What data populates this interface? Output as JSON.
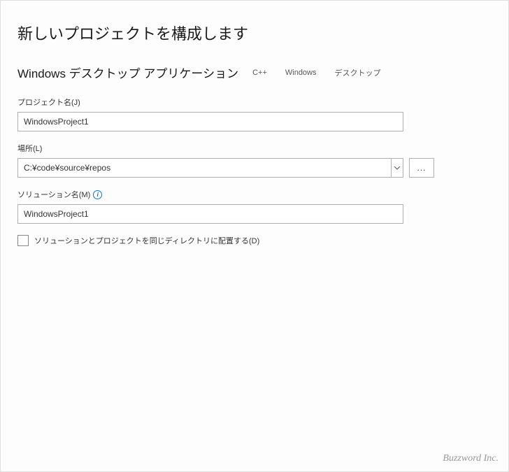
{
  "title": "新しいプロジェクトを構成します",
  "template": {
    "name": "Windows デスクトップ アプリケーション",
    "tags": [
      "C++",
      "Windows",
      "デスクトップ"
    ]
  },
  "fields": {
    "projectName": {
      "label": "プロジェクト名(J)",
      "value": "WindowsProject1"
    },
    "location": {
      "label": "場所(L)",
      "value": "C:¥code¥source¥repos",
      "browseText": "..."
    },
    "solutionName": {
      "label": "ソリューション名(M)",
      "value": "WindowsProject1"
    }
  },
  "checkbox": {
    "label": "ソリューションとプロジェクトを同じディレクトリに配置する(D)"
  },
  "footer": "Buzzword Inc."
}
